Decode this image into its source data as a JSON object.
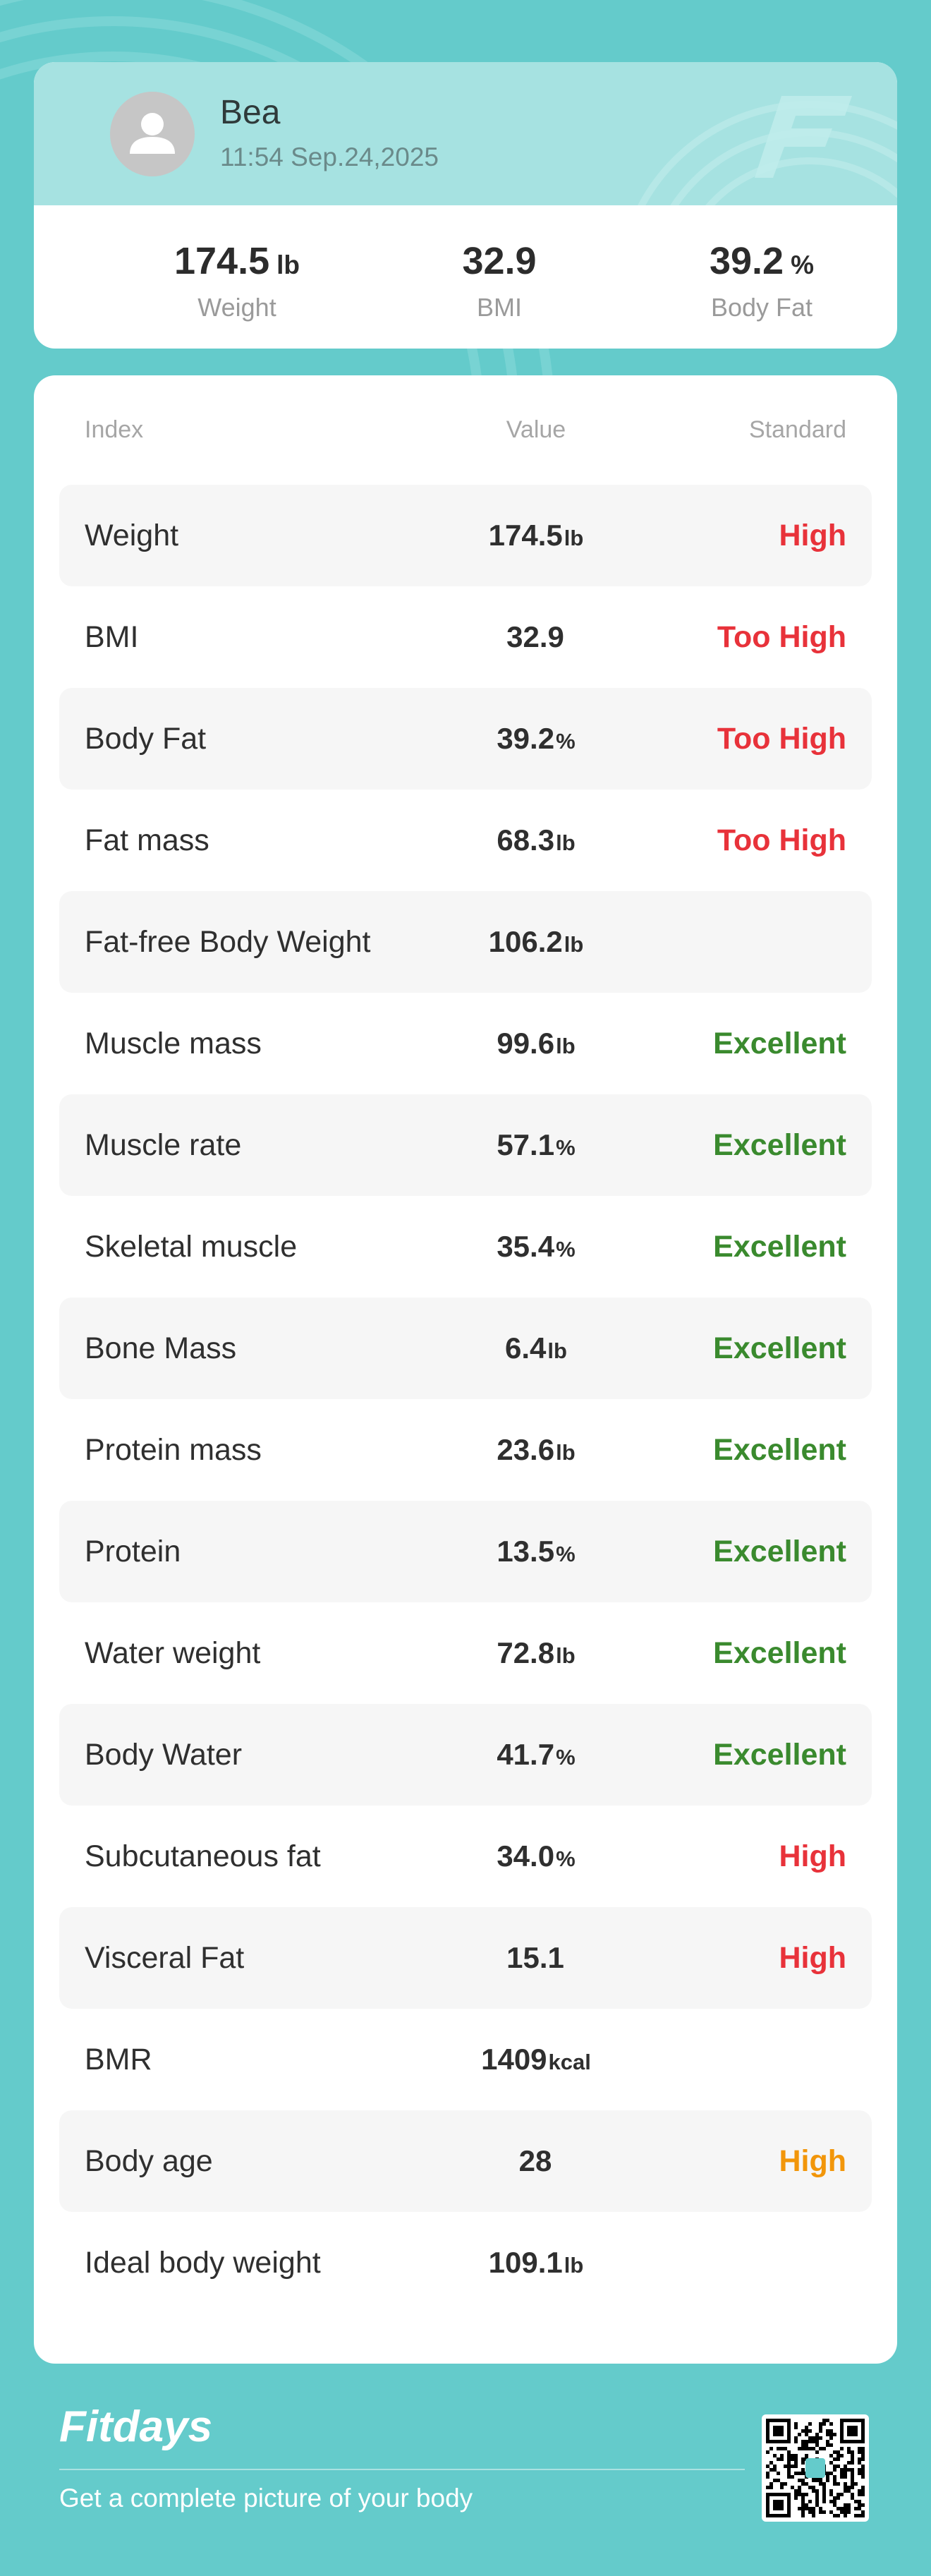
{
  "profile": {
    "name": "Bea",
    "timestamp": "11:54 Sep.24,2025",
    "summary": [
      {
        "value": "174.5",
        "unit": "lb",
        "label": "Weight"
      },
      {
        "value": "32.9",
        "unit": "",
        "label": "BMI"
      },
      {
        "value": "39.2",
        "unit": "%",
        "label": "Body Fat"
      }
    ]
  },
  "table": {
    "headers": {
      "index": "Index",
      "value": "Value",
      "standard": "Standard"
    },
    "rows": [
      {
        "index": "Weight",
        "value": "174.5",
        "unit": "lb",
        "standard": "High",
        "status": "high"
      },
      {
        "index": "BMI",
        "value": "32.9",
        "unit": "",
        "standard": "Too High",
        "status": "high"
      },
      {
        "index": "Body Fat",
        "value": "39.2",
        "unit": "%",
        "standard": "Too High",
        "status": "high"
      },
      {
        "index": "Fat mass",
        "value": "68.3",
        "unit": "lb",
        "standard": "Too High",
        "status": "high"
      },
      {
        "index": "Fat-free Body Weight",
        "value": "106.2",
        "unit": "lb",
        "standard": "",
        "status": "none"
      },
      {
        "index": "Muscle mass",
        "value": "99.6",
        "unit": "lb",
        "standard": "Excellent",
        "status": "good"
      },
      {
        "index": "Muscle rate",
        "value": "57.1",
        "unit": "%",
        "standard": "Excellent",
        "status": "good"
      },
      {
        "index": "Skeletal muscle",
        "value": "35.4",
        "unit": "%",
        "standard": "Excellent",
        "status": "good"
      },
      {
        "index": "Bone Mass",
        "value": "6.4",
        "unit": "lb",
        "standard": "Excellent",
        "status": "good"
      },
      {
        "index": "Protein mass",
        "value": "23.6",
        "unit": "lb",
        "standard": "Excellent",
        "status": "good"
      },
      {
        "index": "Protein",
        "value": "13.5",
        "unit": "%",
        "standard": "Excellent",
        "status": "good"
      },
      {
        "index": "Water weight",
        "value": "72.8",
        "unit": "lb",
        "standard": "Excellent",
        "status": "good"
      },
      {
        "index": "Body Water",
        "value": "41.7",
        "unit": "%",
        "standard": "Excellent",
        "status": "good"
      },
      {
        "index": "Subcutaneous fat",
        "value": "34.0",
        "unit": "%",
        "standard": "High",
        "status": "high"
      },
      {
        "index": "Visceral Fat",
        "value": "15.1",
        "unit": "",
        "standard": "High",
        "status": "high"
      },
      {
        "index": "BMR",
        "value": "1409",
        "unit": "kcal",
        "standard": "",
        "status": "none"
      },
      {
        "index": "Body age",
        "value": "28",
        "unit": "",
        "standard": "High",
        "status": "warn"
      },
      {
        "index": "Ideal body weight",
        "value": "109.1",
        "unit": "lb",
        "standard": "",
        "status": "none"
      }
    ]
  },
  "status_colors": {
    "high": "#e8323a",
    "good": "#3a8a2e",
    "warn": "#f2960a",
    "none": "#2f2f2f"
  },
  "theme": {
    "background": "#64cbcb",
    "header_band": "#a6e2e1"
  },
  "footer": {
    "brand": "Fitdays",
    "tagline": "Get a complete picture of your body"
  },
  "icons": {
    "avatar": "person-silhouette",
    "brand_mark": "fitdays-f-logo",
    "qr": "qr-code"
  }
}
